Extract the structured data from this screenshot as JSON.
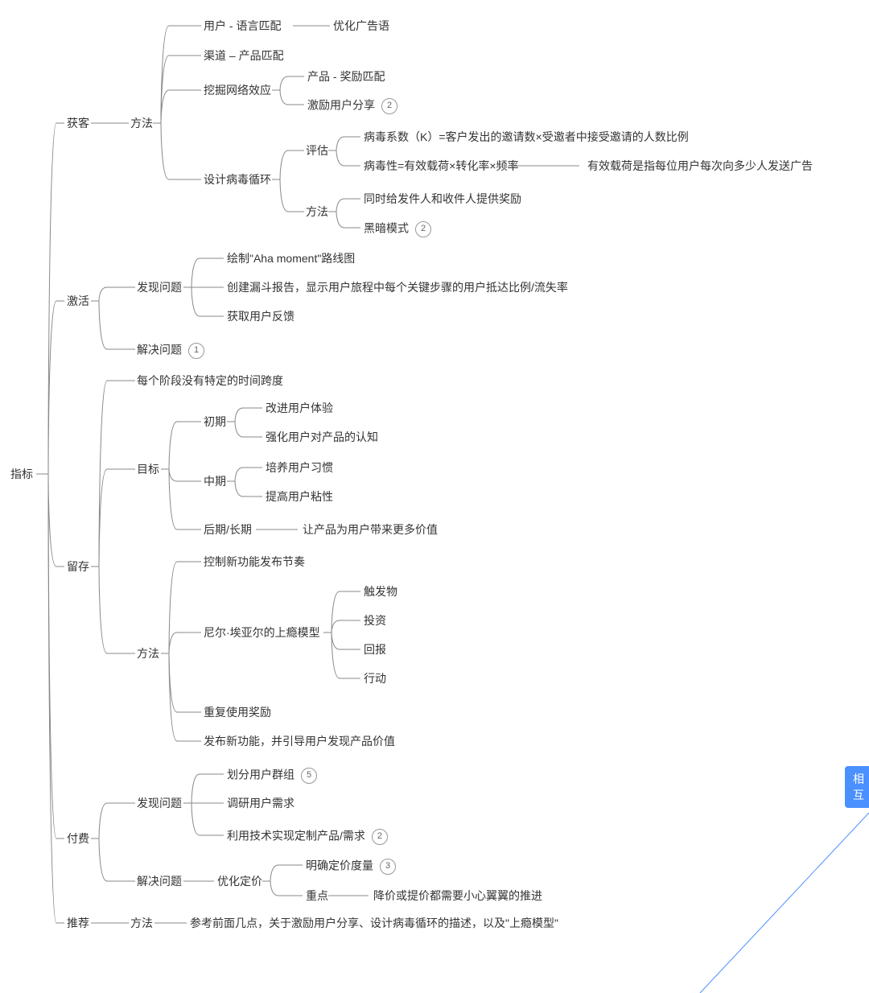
{
  "root": "指标",
  "b1": {
    "label": "获客",
    "methods": "方法",
    "m1": {
      "label": "用户 - 语言匹配",
      "r": "优化广告语"
    },
    "m2": "渠道 – 产品匹配",
    "m3": {
      "label": "挖掘网络效应",
      "c1": "产品 - 奖励匹配",
      "c2": "激励用户分享",
      "c2b": "2"
    },
    "m4": {
      "label": "设计病毒循环",
      "eval": {
        "label": "评估",
        "e1": "病毒系数（K）=客户发出的邀请数×受邀者中接受邀请的人数比例",
        "e2": "病毒性=有效载荷×转化率×频率",
        "e2r": "有效载荷是指每位用户每次向多少人发送广告"
      },
      "method": {
        "label": "方法",
        "c1": "同时给发件人和收件人提供奖励",
        "c2": "黑暗模式",
        "c2b": "2"
      }
    }
  },
  "b2": {
    "label": "激活",
    "find": {
      "label": "发现问题",
      "c1": "绘制\"Aha moment\"路线图",
      "c2": "创建漏斗报告，显示用户旅程中每个关键步骤的用户抵达比例/流失率",
      "c3": "获取用户反馈"
    },
    "solve": {
      "label": "解决问题",
      "b": "1"
    }
  },
  "b3": {
    "label": "留存",
    "n1": "每个阶段没有特定的时间跨度",
    "goal": {
      "label": "目标",
      "early": {
        "label": "初期",
        "c1": "改进用户体验",
        "c2": "强化用户对产品的认知"
      },
      "mid": {
        "label": "中期",
        "c1": "培养用户习惯",
        "c2": "提高用户粘性"
      },
      "late": {
        "label": "后期/长期",
        "r": "让产品为用户带来更多价值"
      }
    },
    "method": {
      "label": "方法",
      "c1": "控制新功能发布节奏",
      "model": {
        "label": "尼尔·埃亚尔的上瘾模型",
        "i1": "触发物",
        "i2": "投资",
        "i3": "回报",
        "i4": "行动"
      },
      "c3": "重复使用奖励",
      "c4": "发布新功能，并引导用户发现产品价值"
    }
  },
  "b4": {
    "label": "付费",
    "find": {
      "label": "发现问题",
      "c1": "划分用户群组",
      "c1b": "5",
      "c2": "调研用户需求",
      "c3": "利用技术实现定制产品/需求",
      "c3b": "2"
    },
    "solve": {
      "label": "解决问题",
      "price": {
        "label": "优化定价",
        "c1": "明确定价度量",
        "c1b": "3",
        "focus": {
          "label": "重点",
          "r": "降价或提价都需要小心翼翼的推进"
        }
      }
    }
  },
  "b5": {
    "label": "推荐",
    "method": {
      "label": "方法",
      "r": "参考前面几点，关于激励用户分享、设计病毒循环的描述，以及\"上瘾模型\""
    }
  },
  "tag": "相互"
}
